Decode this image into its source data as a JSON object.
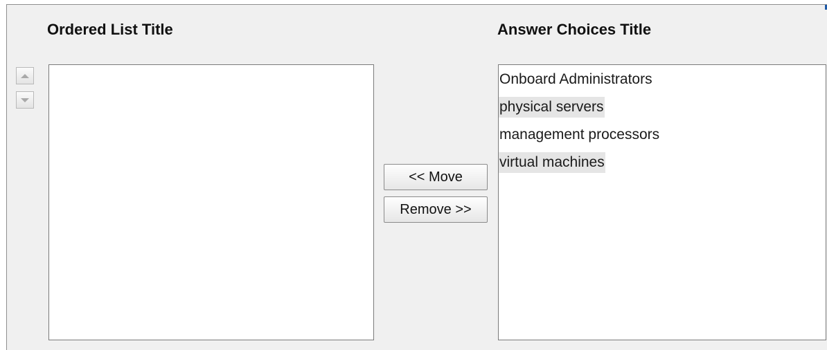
{
  "ordered_list": {
    "title": "Ordered List Title",
    "items": []
  },
  "answer_choices": {
    "title": "Answer Choices Title",
    "items": [
      {
        "label": "Onboard Administrators",
        "shaded": false
      },
      {
        "label": "physical servers",
        "shaded": true
      },
      {
        "label": "management processors",
        "shaded": false
      },
      {
        "label": "virtual machines",
        "shaded": true
      }
    ]
  },
  "buttons": {
    "move_label": "<< Move",
    "remove_label": "Remove >>"
  },
  "icons": {
    "move_up": "arrow-up-icon",
    "move_down": "arrow-down-icon"
  },
  "colors": {
    "panel_bg": "#f0f0f0",
    "shaded_item_bg": "#e5e5e5"
  }
}
